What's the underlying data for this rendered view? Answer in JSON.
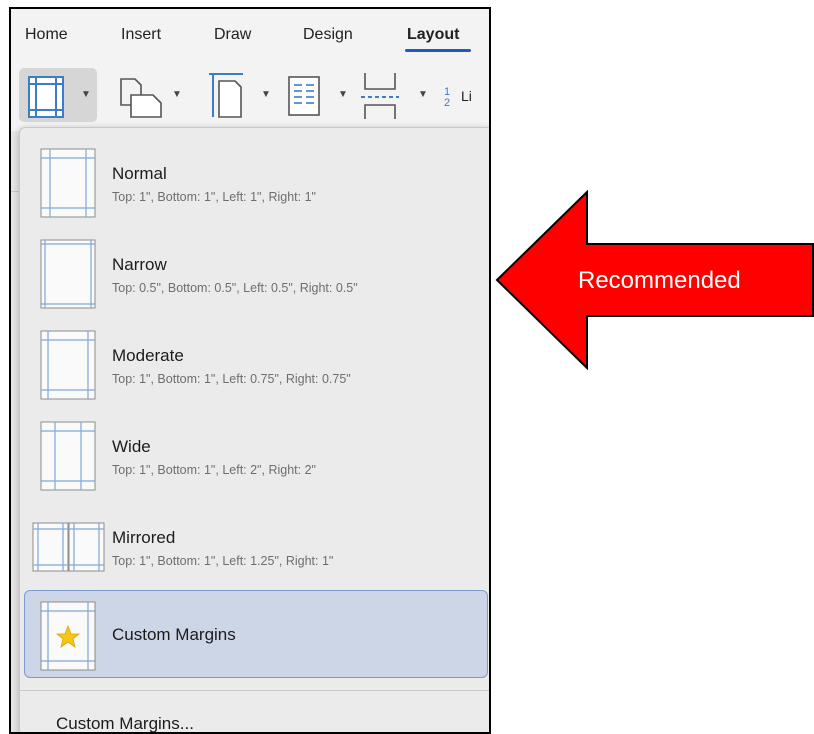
{
  "tabs": [
    "Home",
    "Insert",
    "Draw",
    "Design",
    "Layout"
  ],
  "active_tab": "Layout",
  "ribbon": {
    "line_numbers_label": "Li",
    "line_numbers_numerals": "1 2"
  },
  "menu": {
    "items": [
      {
        "title": "Normal",
        "desc": "Top: 1\", Bottom: 1\", Left: 1\", Right: 1\""
      },
      {
        "title": "Narrow",
        "desc": "Top: 0.5\", Bottom: 0.5\", Left: 0.5\", Right: 0.5\""
      },
      {
        "title": "Moderate",
        "desc": "Top: 1\", Bottom: 1\", Left: 0.75\", Right: 0.75\""
      },
      {
        "title": "Wide",
        "desc": "Top: 1\", Bottom: 1\", Left: 2\", Right: 2\""
      },
      {
        "title": "Mirrored",
        "desc": "Top: 1\", Bottom: 1\", Left: 1.25\", Right: 1\""
      }
    ],
    "custom_item": "Custom Margins",
    "footer": "Custom Margins..."
  },
  "callout": {
    "label": "Recommended"
  },
  "colors": {
    "accent": "#1f5bb8",
    "icon_blue": "#3d7cc9",
    "arrow_red": "#ff0000",
    "selected_bg": "#cdd6e6",
    "star": "#f5c518"
  },
  "icons": [
    "margins-icon",
    "orientation-icon",
    "size-icon",
    "columns-icon",
    "breaks-icon",
    "line-numbers-icon",
    "star-icon",
    "chevron-down-icon"
  ]
}
